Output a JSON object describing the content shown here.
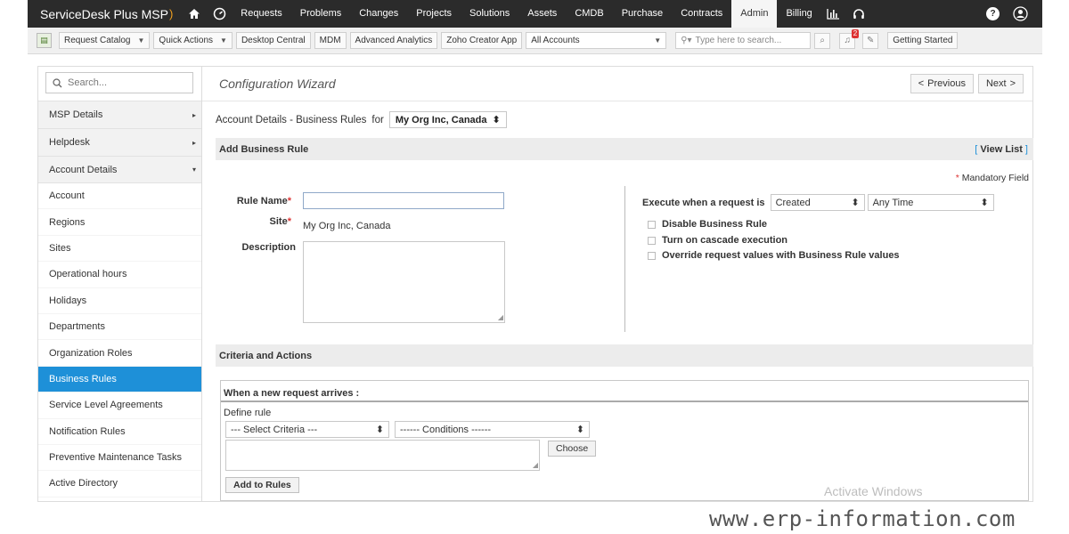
{
  "app": {
    "brand": "ServiceDesk Plus MSP"
  },
  "nav": {
    "items": [
      "Requests",
      "Problems",
      "Changes",
      "Projects",
      "Solutions",
      "Assets",
      "CMDB",
      "Purchase",
      "Contracts",
      "Admin",
      "Billing"
    ],
    "active": "Admin"
  },
  "toolbar": {
    "request_catalog": "Request Catalog",
    "quick_actions": "Quick Actions",
    "desktop_central": "Desktop Central",
    "mdm": "MDM",
    "advanced_analytics": "Advanced Analytics",
    "zoho_creator": "Zoho Creator App",
    "account_select": "All Accounts",
    "search_placeholder": "Type here to search...",
    "notification_count": "2",
    "getting_started": "Getting Started"
  },
  "sidebar": {
    "search_placeholder": "Search...",
    "groups": [
      {
        "label": "MSP Details",
        "arrow": "▸"
      },
      {
        "label": "Helpdesk",
        "arrow": "▸"
      },
      {
        "label": "Account Details",
        "arrow": "▾"
      }
    ],
    "items": [
      {
        "label": "Account"
      },
      {
        "label": "Regions"
      },
      {
        "label": "Sites"
      },
      {
        "label": "Operational hours"
      },
      {
        "label": "Holidays"
      },
      {
        "label": "Departments"
      },
      {
        "label": "Organization Roles"
      },
      {
        "label": "Business Rules"
      },
      {
        "label": "Service Level Agreements"
      },
      {
        "label": "Notification Rules"
      },
      {
        "label": "Preventive Maintenance Tasks"
      },
      {
        "label": "Active Directory"
      }
    ],
    "active_item": "Business Rules"
  },
  "wizard": {
    "title": "Configuration Wizard",
    "previous": "Previous",
    "next": "Next"
  },
  "account_line": {
    "label": "Account Details - Business Rules",
    "for": "for",
    "org": "My Org Inc, Canada"
  },
  "add_rule": {
    "header": "Add Business Rule",
    "view_list": "View List",
    "mandatory": "Mandatory Field",
    "rule_name_label": "Rule Name",
    "rule_name_value": "",
    "site_label": "Site",
    "site_value": "My Org Inc, Canada",
    "description_label": "Description",
    "execute_label": "Execute when a request is",
    "execute_value": "Created",
    "time_value": "Any Time",
    "checkboxes": [
      {
        "label": "Disable Business Rule",
        "checked": false
      },
      {
        "label": "Turn on cascade execution",
        "checked": false
      },
      {
        "label": "Override request values with Business Rule values",
        "checked": false
      }
    ]
  },
  "criteria": {
    "header": "Criteria and Actions",
    "arrives": "When a new request arrives :",
    "define_rule": "Define rule",
    "select_criteria": "--- Select Criteria ---",
    "conditions": "------ Conditions ------",
    "choose": "Choose",
    "add_to_rules": "Add to Rules"
  },
  "overlay": {
    "activate": "Activate Windows",
    "watermark": "www.erp-information.com"
  }
}
